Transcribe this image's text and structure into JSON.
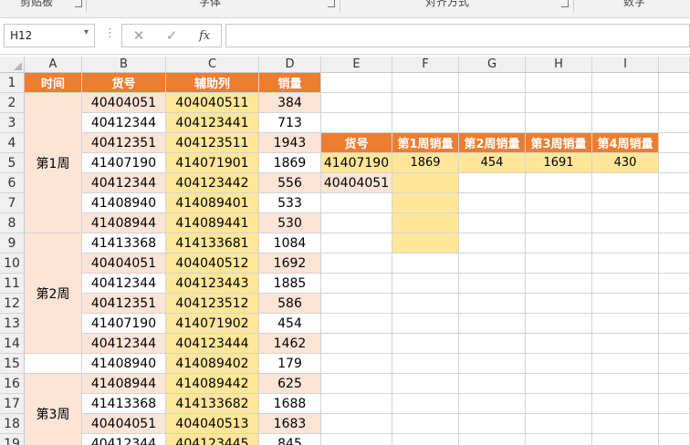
{
  "ribbon": {
    "groups": [
      "剪贴板",
      "字体",
      "对齐方式",
      "数字"
    ]
  },
  "formula_bar": {
    "name_box": "H12",
    "dropdown_icon": "chevron-down-icon",
    "cancel_icon": "close-icon",
    "enter_icon": "check-icon",
    "fx_label": "fx",
    "formula": ""
  },
  "columns": [
    "A",
    "B",
    "C",
    "D",
    "E",
    "F",
    "G",
    "H",
    "I"
  ],
  "rows": [
    "1",
    "2",
    "3",
    "4",
    "5",
    "6",
    "7",
    "8",
    "9",
    "10",
    "11",
    "12",
    "13",
    "14",
    "15",
    "16",
    "17",
    "18",
    "19"
  ],
  "table": {
    "headers": [
      "时间",
      "货号",
      "辅助列",
      "销量"
    ],
    "weeks": [
      "第1周",
      "第2周",
      "第3周"
    ],
    "data": [
      [
        "40404051",
        "404040511",
        "384"
      ],
      [
        "40412344",
        "404123441",
        "713"
      ],
      [
        "40412351",
        "404123511",
        "1943"
      ],
      [
        "41407190",
        "414071901",
        "1869"
      ],
      [
        "40412344",
        "404123442",
        "556"
      ],
      [
        "41408940",
        "414089401",
        "533"
      ],
      [
        "41408944",
        "414089441",
        "530"
      ],
      [
        "41413368",
        "414133681",
        "1084"
      ],
      [
        "40404051",
        "404040512",
        "1692"
      ],
      [
        "40412344",
        "404123443",
        "1885"
      ],
      [
        "40412351",
        "404123512",
        "586"
      ],
      [
        "41407190",
        "414071902",
        "454"
      ],
      [
        "40412344",
        "404123444",
        "1462"
      ],
      [
        "41408940",
        "414089402",
        "179"
      ],
      [
        "41408944",
        "414089442",
        "625"
      ],
      [
        "41413368",
        "414133682",
        "1688"
      ],
      [
        "40404051",
        "404040513",
        "1683"
      ],
      [
        "40412344",
        "404123445",
        "845"
      ]
    ]
  },
  "lookup": {
    "headers": [
      "货号",
      "第1周销量",
      "第2周销量",
      "第3周销量",
      "第4周销量"
    ],
    "row1": [
      "41407190",
      "1869",
      "454",
      "1691",
      "430"
    ],
    "row2": [
      "40404051",
      "",
      "",
      "",
      ""
    ]
  },
  "colors": {
    "header_orange": "#ed7d31",
    "peach": "#fce4d6",
    "yellow": "#ffe699"
  }
}
